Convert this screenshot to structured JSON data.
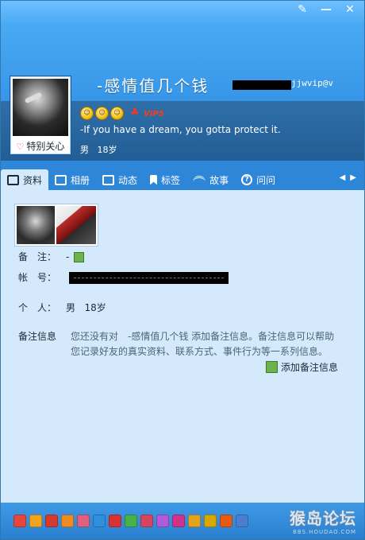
{
  "window": {
    "buttons": {
      "skin": "✎",
      "minimize": "—",
      "close": "✕"
    }
  },
  "profile": {
    "nickname": "-感情值几个钱",
    "account_tail": "jjwvip@v",
    "special_care": "特别关心",
    "vip_badge": "VIP5",
    "signature": "-If you have a dream, you gotta protect it.",
    "gender": "男",
    "age": "18岁",
    "smileys": [
      "☺",
      "☺",
      "☺"
    ],
    "penguin_icon": "qq-penguin-icon"
  },
  "tabs": [
    {
      "label": "资料",
      "icon": "profile-card-icon",
      "active": true
    },
    {
      "label": "相册",
      "icon": "album-icon",
      "active": false
    },
    {
      "label": "动态",
      "icon": "feed-icon",
      "active": false
    },
    {
      "label": "标签",
      "icon": "bookmark-icon",
      "active": false
    },
    {
      "label": "故事",
      "icon": "signal-icon",
      "active": false
    },
    {
      "label": "问问",
      "icon": "question-icon",
      "active": false
    }
  ],
  "tab_arrows": "◀▶",
  "details": {
    "remark_label": "备　注：",
    "remark_value": "-",
    "account_label": "帐　号：",
    "person_label": "个　人：",
    "person_gender": "男",
    "person_age": "18岁",
    "note_label": "备注信息",
    "note_text": "您还没有对　-感情值几个钱 添加备注信息。备注信息可以帮助您记录好友的真实资料、联系方式、事件行为等一系列信息。",
    "add_note": "添加备注信息"
  },
  "badge_colors": [
    "#e8453c",
    "#f2a51c",
    "#d63a2f",
    "#f08a24",
    "#e0607e",
    "#2f8fdc",
    "#d83333",
    "#49b14a",
    "#d6445e",
    "#b25bd6",
    "#d2338a",
    "#e5a21c",
    "#d9a800",
    "#e65a12",
    "#4a7fd0"
  ],
  "watermark": {
    "title": "猴岛论坛",
    "url": "BBS.HOUDAO.COM"
  }
}
